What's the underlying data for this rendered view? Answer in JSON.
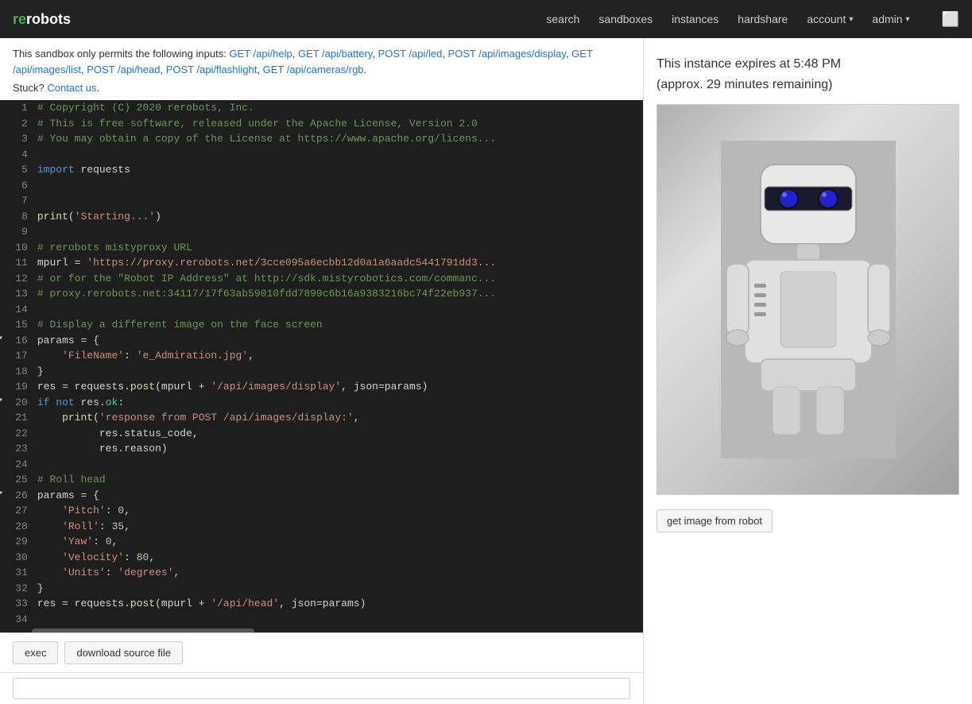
{
  "nav": {
    "logo_re": "re",
    "logo_robots": "robots",
    "links": [
      {
        "label": "search",
        "href": "#"
      },
      {
        "label": "sandboxes",
        "href": "#"
      },
      {
        "label": "instances",
        "href": "#"
      },
      {
        "label": "hardshare",
        "href": "#"
      }
    ],
    "dropdowns": [
      {
        "label": "account"
      },
      {
        "label": "admin"
      }
    ]
  },
  "sandbox": {
    "notice_prefix": "This sandbox only permits the following inputs:",
    "links": [
      "GET /api/help",
      "GET /api/battery",
      "POST /api/led",
      "POST /api/images/display",
      "GET /api/images/list",
      "POST /api/head",
      "POST /api/flashlight",
      "GET /api/cameras/rgb"
    ],
    "stuck_text": "Stuck?",
    "contact_us": "Contact us",
    "contact_href": "#"
  },
  "instance": {
    "expiry_line1": "This instance expires at 5:48 PM",
    "expiry_line2": "(approx. 29 minutes remaining)"
  },
  "buttons": {
    "exec": "exec",
    "download": "download source file",
    "get_image": "get image from robot"
  },
  "code_lines": [
    {
      "num": 1,
      "arrow": false,
      "content": "comment",
      "text": "# Copyright (C) 2020 rerobots, Inc."
    },
    {
      "num": 2,
      "arrow": false,
      "content": "comment",
      "text": "# This is free software, released under the Apache License, Version 2.0"
    },
    {
      "num": 3,
      "arrow": false,
      "content": "comment",
      "text": "# You may obtain a copy of the License at https://www.apache.org/licens..."
    },
    {
      "num": 4,
      "arrow": false,
      "content": "empty",
      "text": ""
    },
    {
      "num": 5,
      "arrow": false,
      "content": "import",
      "text": "import_requests"
    },
    {
      "num": 6,
      "arrow": false,
      "content": "empty",
      "text": ""
    },
    {
      "num": 7,
      "arrow": false,
      "content": "empty",
      "text": ""
    },
    {
      "num": 8,
      "arrow": false,
      "content": "print_starting",
      "text": "print_starting"
    },
    {
      "num": 9,
      "arrow": false,
      "content": "empty",
      "text": ""
    },
    {
      "num": 10,
      "arrow": false,
      "content": "comment",
      "text": "# rerobots mistyproxy URL"
    },
    {
      "num": 11,
      "arrow": false,
      "content": "mpurl",
      "text": "mpurl = 'https://proxy.rerobots.net/3cce095a6ecbb12d0a1a6aadc5441791dd3..."
    },
    {
      "num": 12,
      "arrow": false,
      "content": "comment",
      "text": "# or for the \"Robot IP Address\" at http://sdk.mistyrobotics.com/commanc..."
    },
    {
      "num": 13,
      "arrow": false,
      "content": "comment",
      "text": "# proxy.rerobots.net:34117/17f63ab59010fdd7899c6b16a9383216bc74f22eb937..."
    },
    {
      "num": 14,
      "arrow": false,
      "content": "empty",
      "text": ""
    },
    {
      "num": 15,
      "arrow": false,
      "content": "comment",
      "text": "# Display a different image on the face screen"
    },
    {
      "num": 16,
      "arrow": true,
      "content": "params_open",
      "text": "params_open"
    },
    {
      "num": 17,
      "arrow": false,
      "content": "filename",
      "text": "filename"
    },
    {
      "num": 18,
      "arrow": false,
      "content": "close_brace",
      "text": "}"
    },
    {
      "num": 19,
      "arrow": false,
      "content": "res_post_display",
      "text": "res_post_display"
    },
    {
      "num": 20,
      "arrow": true,
      "content": "if_not",
      "text": "if_not"
    },
    {
      "num": 21,
      "arrow": false,
      "content": "print_response",
      "text": "print_response"
    },
    {
      "num": 22,
      "arrow": false,
      "content": "res_status",
      "text": "res.status_code,"
    },
    {
      "num": 23,
      "arrow": false,
      "content": "res_reason",
      "text": "res.reason)"
    },
    {
      "num": 24,
      "arrow": false,
      "content": "empty",
      "text": ""
    },
    {
      "num": 25,
      "arrow": false,
      "content": "comment_roll",
      "text": "# Roll head"
    },
    {
      "num": 26,
      "arrow": true,
      "content": "params_open2",
      "text": "params_open2"
    },
    {
      "num": 27,
      "arrow": false,
      "content": "pitch",
      "text": "pitch"
    },
    {
      "num": 28,
      "arrow": false,
      "content": "roll",
      "text": "roll"
    },
    {
      "num": 29,
      "arrow": false,
      "content": "yaw",
      "text": "yaw"
    },
    {
      "num": 30,
      "arrow": false,
      "content": "velocity",
      "text": "velocity"
    },
    {
      "num": 31,
      "arrow": false,
      "content": "units",
      "text": "units"
    },
    {
      "num": 32,
      "arrow": false,
      "content": "close_brace2",
      "text": "}"
    },
    {
      "num": 33,
      "arrow": false,
      "content": "res_post_head",
      "text": "res_post_head"
    },
    {
      "num": 34,
      "arrow": false,
      "content": "empty2",
      "text": ""
    }
  ]
}
